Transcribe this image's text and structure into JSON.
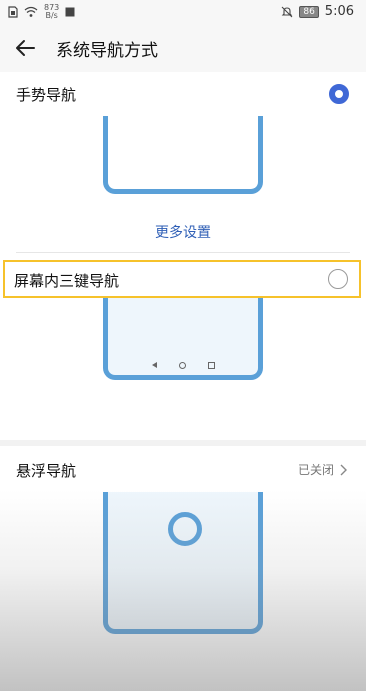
{
  "status_bar": {
    "speed_value": "873",
    "speed_unit": "B/s",
    "battery": "86",
    "time": "5:06"
  },
  "header": {
    "title": "系统导航方式"
  },
  "options": {
    "gesture_label": "手势导航",
    "more_settings": "更多设置",
    "three_key_label": "屏幕内三键导航",
    "floating_label": "悬浮导航",
    "floating_status": "已关闭"
  },
  "icons": {
    "back": "back-arrow-icon",
    "sim": "sim-card-icon",
    "wifi": "wifi-icon",
    "image": "image-icon",
    "mute": "mute-icon",
    "battery": "battery-icon",
    "chevron": "chevron-right-icon"
  },
  "colors": {
    "accent": "#3f68d6",
    "illustration": "#5aa0d8",
    "highlight": "#f6c22b"
  }
}
